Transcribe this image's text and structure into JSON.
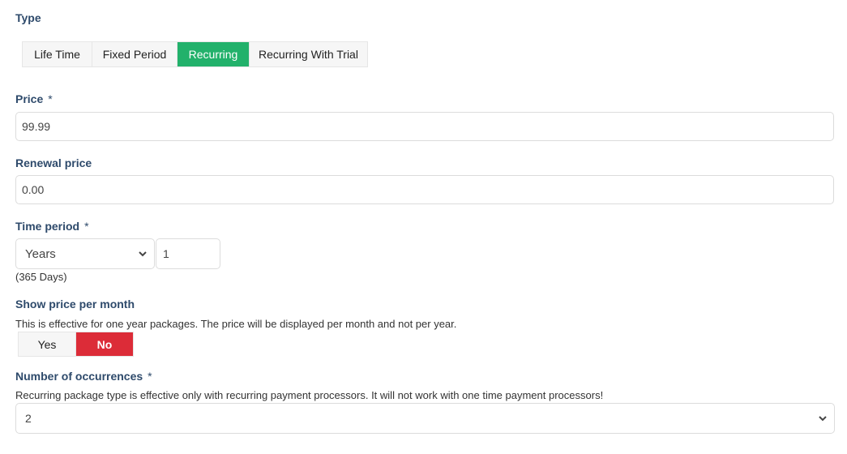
{
  "type": {
    "label": "Type",
    "options": [
      "Life Time",
      "Fixed Period",
      "Recurring",
      "Recurring With Trial"
    ],
    "selected": "Recurring",
    "active_color": "#22b16b"
  },
  "price": {
    "label": "Price",
    "required_mark": "*",
    "value": "99.99"
  },
  "renewal_price": {
    "label": "Renewal price",
    "value": "0.00"
  },
  "time_period": {
    "label": "Time period",
    "required_mark": "*",
    "unit_selected": "Years",
    "amount": "1",
    "days_note": "(365 Days)"
  },
  "show_price_per_month": {
    "label": "Show price per month",
    "help": "This is effective for one year packages. The price will be displayed per month and not per year.",
    "options": [
      "Yes",
      "No"
    ],
    "selected": "No",
    "active_color": "#dc2c38"
  },
  "occurrences": {
    "label": "Number of occurrences",
    "required_mark": "*",
    "help": "Recurring package type is effective only with recurring payment processors. It will not work with one time payment processors!",
    "selected": "2"
  }
}
